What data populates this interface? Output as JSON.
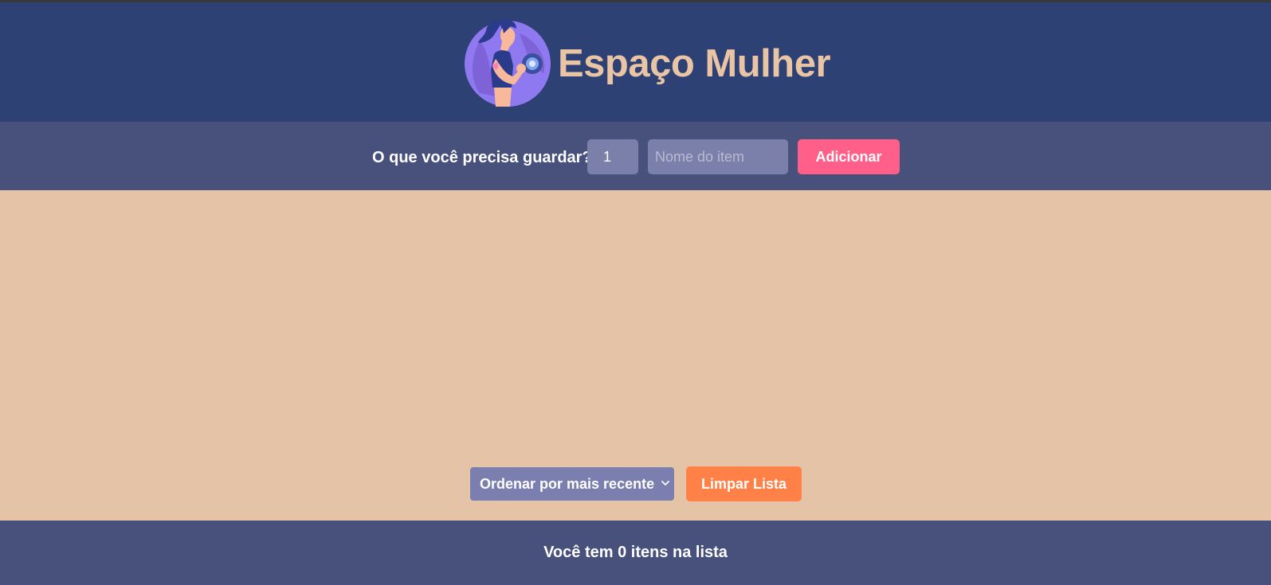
{
  "header": {
    "title": "Espaço Mulher",
    "logo_icon": "woman-lifting-dumbbell-icon"
  },
  "form": {
    "prompt": "O que você precisa guardar?",
    "quantity_value": "1",
    "item_placeholder": "Nome do item",
    "add_label": "Adicionar"
  },
  "controls": {
    "sort_selected": "Ordenar por mais recente",
    "clear_label": "Limpar Lista"
  },
  "footer": {
    "summary": "Você tem 0 itens na lista"
  },
  "colors": {
    "header_bg": "#2e4174",
    "bar_bg": "#48507c",
    "content_bg": "#e4c3a6",
    "title": "#e9c4a5",
    "add_button": "#ff5f88",
    "clear_button": "#ff8148",
    "input_bg": "#7a80aa"
  }
}
